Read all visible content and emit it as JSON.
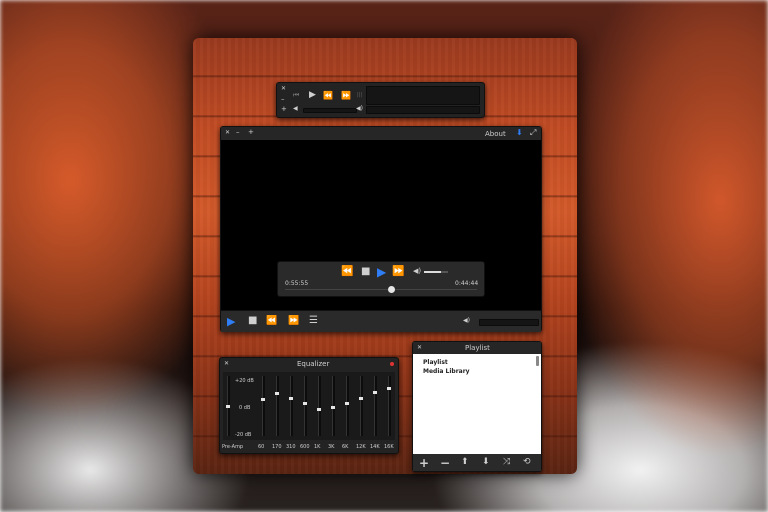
{
  "mini_player": {
    "close_icon": "✕",
    "min_icon": "–",
    "add_icon": "+",
    "prev_icon": "⏮",
    "play_icon": "▶",
    "rewind_icon": "⏪",
    "forward_icon": "⏩",
    "divider": "|||",
    "vol_icon": "◀",
    "vol_right_icon": "◀)"
  },
  "main_window": {
    "close_icon": "✕",
    "min_icon": "–",
    "add_icon": "+",
    "about_label": "About",
    "download_icon": "⬇",
    "fullscreen_icon": "⤢"
  },
  "osd": {
    "elapsed": "0:55:55",
    "remaining": "0:44:44",
    "rewind_icon": "⏪",
    "stop_icon": "■",
    "play_icon": "▶",
    "forward_icon": "⏩",
    "volume_icon": "◀)",
    "volume_level": 0.7,
    "progress": 0.55
  },
  "bottom_bar": {
    "play_icon": "▶",
    "stop_icon": "■",
    "rewind_icon": "⏪",
    "forward_icon": "⏩",
    "playlist_icon": "☰",
    "volume_icon": "◀)"
  },
  "equalizer": {
    "title": "Equalizer",
    "close_icon": "✕",
    "label_top": "+20 dB",
    "label_mid": "0 dB",
    "label_bottom": "-20 dB",
    "bands": [
      {
        "label": "Pre-Amp",
        "level": 0.0
      },
      {
        "label": "60",
        "level": 0.25
      },
      {
        "label": "170",
        "level": 0.45
      },
      {
        "label": "310",
        "level": 0.3
      },
      {
        "label": "600",
        "level": 0.1
      },
      {
        "label": "1K",
        "level": -0.1
      },
      {
        "label": "3K",
        "level": -0.05
      },
      {
        "label": "6K",
        "level": 0.1
      },
      {
        "label": "12K",
        "level": 0.3
      },
      {
        "label": "14K",
        "level": 0.5
      },
      {
        "label": "16K",
        "level": 0.65
      }
    ]
  },
  "playlist": {
    "title": "Playlist",
    "close_icon": "✕",
    "items": [
      "Playlist",
      "Media Library"
    ],
    "add_icon": "+",
    "remove_icon": "−",
    "up_icon": "⬆",
    "down_icon": "⬇",
    "shuffle_icon": "⤨",
    "repeat_icon": "⟲"
  },
  "colors": {
    "accent": "#2f7ef5",
    "panel": "#232323",
    "wood": "#c04b24"
  }
}
